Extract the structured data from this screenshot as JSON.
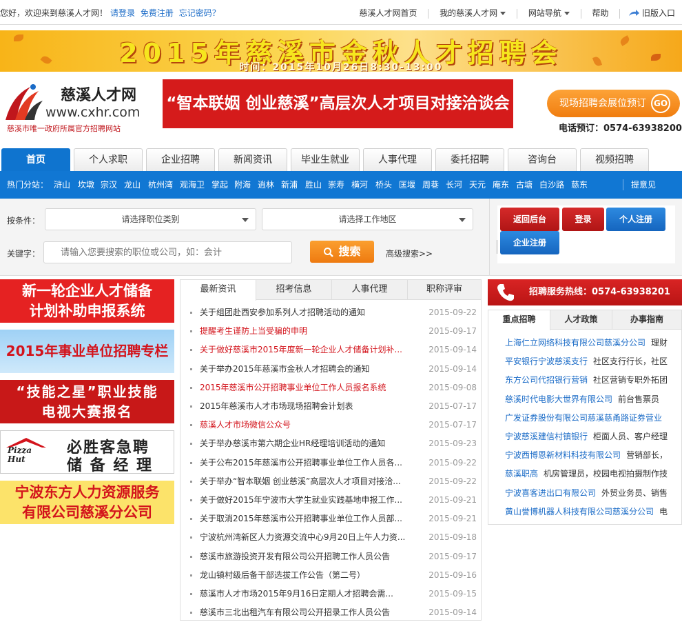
{
  "topbar": {
    "greeting": "您好，欢迎来到慈溪人才网！",
    "login": "请登录",
    "register": "免费注册",
    "forgot": "忘记密码？",
    "home": "慈溪人才网首页",
    "my": "我的慈溪人才网",
    "sitenav": "网站导航",
    "help": "帮助",
    "oldver": "旧版入口"
  },
  "banner": {
    "title": "2015年慈溪市金秋人才招聘会",
    "time": "时间：2015年10月26日8:30-13:00"
  },
  "logo": {
    "name": "慈溪人才网",
    "url": "www.cxhr.com",
    "slogan": "慈溪市唯一政府所属官方招聘网站"
  },
  "ad_main": "“智本联姻 创业慈溪”高层次人才项目对接洽谈会",
  "booking": {
    "label": "现场招聘会展位预订",
    "go": "GO",
    "phone": "电话预订：0574-63938200"
  },
  "nav": {
    "tabs": [
      "首页",
      "个人求职",
      "企业招聘",
      "新闻资讯",
      "毕业生就业",
      "人事代理",
      "委托招聘",
      "咨询台",
      "视频招聘"
    ]
  },
  "cities": {
    "label": "热门分站：",
    "items": [
      "浒山",
      "坎墩",
      "宗汉",
      "龙山",
      "杭州湾",
      "观海卫",
      "掌起",
      "附海",
      "逍林",
      "新浦",
      "胜山",
      "崇寿",
      "横河",
      "桥头",
      "匡堰",
      "周巷",
      "长河",
      "天元",
      "庵东",
      "古塘",
      "白沙路",
      "慈东"
    ],
    "more": "提意见"
  },
  "search": {
    "cond_label": "按条件：",
    "job_type": "请选择职位类别",
    "area": "请选择工作地区",
    "kw_label": "关键字：",
    "kw_placeholder": "请输入您要搜索的职位或公司，如：会计",
    "button": "搜索",
    "advanced": "高级搜索>>"
  },
  "account": {
    "back": "返回后台",
    "login": "登录",
    "personal_reg": "个人注册",
    "company_reg": "企业注册"
  },
  "left_ads": [
    {
      "line1": "新一轮企业人才储备",
      "line2": "计划补助申报系统"
    },
    {
      "line1": "2015年事业单位招聘专栏",
      "line2": ""
    },
    {
      "line1": "“技能之星”职业技能",
      "line2": "电视大赛报名"
    },
    {
      "line1": "必胜客急聘",
      "line2": "储 备 经 理",
      "logo": "Pizza Hut"
    },
    {
      "line1": "宁波东方人力资源服务",
      "line2": "有限公司慈溪分公司"
    }
  ],
  "news": {
    "tabs": [
      "最新资讯",
      "招考信息",
      "人事代理",
      "职称评审"
    ],
    "items": [
      {
        "title": "关于组团赴西安参加系列人才招聘活动的通知",
        "date": "2015-09-22",
        "red": false
      },
      {
        "title": "提醒考生谨防上当受骗的申明",
        "date": "2015-09-17",
        "red": true
      },
      {
        "title": "关于做好慈溪市2015年度新一轮企业人才储备计划补...",
        "date": "2015-09-14",
        "red": true
      },
      {
        "title": "关于举办2015年慈溪市金秋人才招聘会的通知",
        "date": "2015-09-14",
        "red": false
      },
      {
        "title": "2015年慈溪市公开招聘事业单位工作人员报名系统",
        "date": "2015-09-08",
        "red": true
      },
      {
        "title": "2015年慈溪市人才市场现场招聘会计划表",
        "date": "2015-07-17",
        "red": false
      },
      {
        "title": "慈溪人才市场微信公众号",
        "date": "2015-07-17",
        "red": true
      },
      {
        "title": "关于举办慈溪市第六期企业HR经理培训活动的通知",
        "date": "2015-09-23",
        "red": false
      },
      {
        "title": "关于公布2015年慈溪市公开招聘事业单位工作人员各...",
        "date": "2015-09-22",
        "red": false
      },
      {
        "title": "关于举办“智本联姻 创业慈溪”高层次人才项目对接洽...",
        "date": "2015-09-22",
        "red": false
      },
      {
        "title": "关于做好2015年宁波市大学生就业实践基地申报工作...",
        "date": "2015-09-21",
        "red": false
      },
      {
        "title": "关于取消2015年慈溪市公开招聘事业单位工作人员部...",
        "date": "2015-09-21",
        "red": false
      },
      {
        "title": "宁波杭州湾新区人力资源交流中心9月20日上午人力资...",
        "date": "2015-09-18",
        "red": false
      },
      {
        "title": "慈溪市旅游投资开发有限公司公开招聘工作人员公告",
        "date": "2015-09-17",
        "red": false
      },
      {
        "title": "龙山镇村级后备干部选拔工作公告（第二号）",
        "date": "2015-09-16",
        "red": false
      },
      {
        "title": "慈溪市人才市场2015年9月16日定期人才招聘会需...",
        "date": "2015-09-15",
        "red": false
      },
      {
        "title": "慈溪市三北出租汽车有限公司公开招录工作人员公告",
        "date": "2015-09-14",
        "red": false
      }
    ]
  },
  "hotline": "招聘服务热线：0574-63938201",
  "right": {
    "tabs": [
      "重点招聘",
      "人才政策",
      "办事指南"
    ],
    "jobs": [
      {
        "company": "上海仁立网络科技有限公司慈溪分公司",
        "jobs": "理财"
      },
      {
        "company": "平安银行宁波慈溪支行",
        "jobs": "社区支行行长，社区"
      },
      {
        "company": "东方公司代招银行营销",
        "jobs": "社区营销专职外拓团"
      },
      {
        "company": "慈溪时代电影大世界有限公司",
        "jobs": "前台售票员"
      },
      {
        "company": "广发证券股份有限公司慈溪慈甬路证券营业",
        "jobs": ""
      },
      {
        "company": "宁波慈溪建信村镇银行",
        "jobs": "柜面人员、客户经理"
      },
      {
        "company": "宁波西博恩新材料科技有限公司",
        "jobs": "营销部长，"
      },
      {
        "company": "慈溪职高",
        "jobs": "机房管理员，校园电视拍摄制作技"
      },
      {
        "company": "宁波喜客进出口有限公司",
        "jobs": "外贸业务员、销售"
      },
      {
        "company": "黄山誉博机器人科技有限公司慈溪分公司",
        "jobs": "电"
      }
    ]
  }
}
